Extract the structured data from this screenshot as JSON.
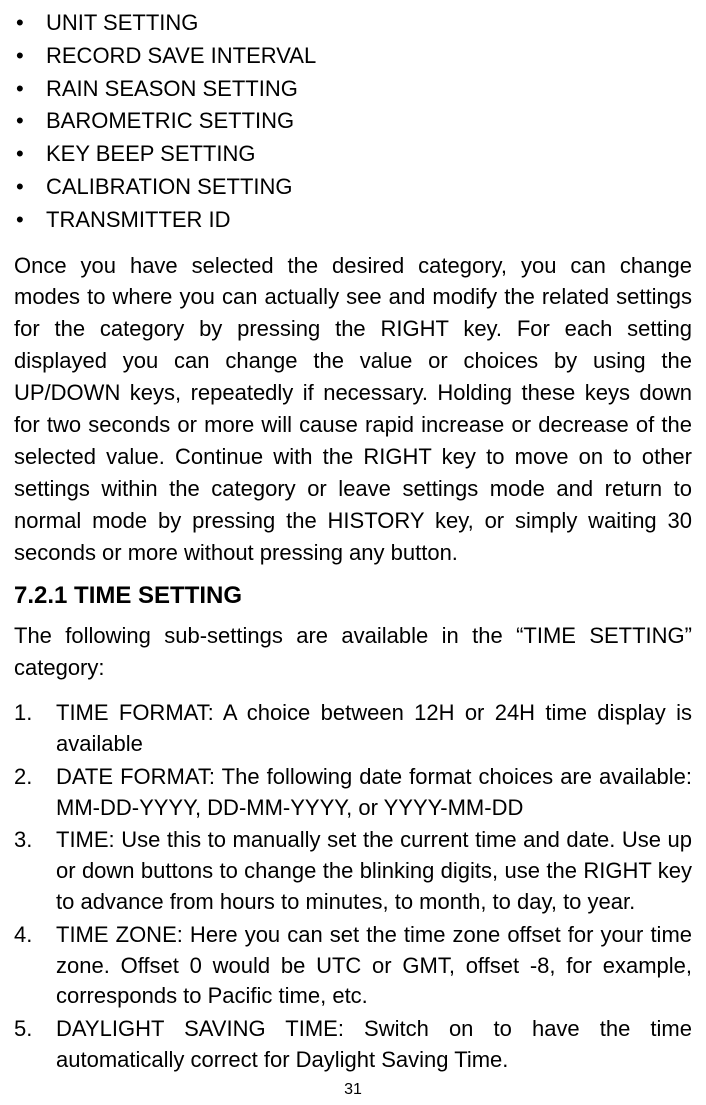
{
  "bullets": [
    "UNIT SETTING",
    "RECORD SAVE INTERVAL",
    "RAIN SEASON SETTING",
    "BAROMETRIC SETTING",
    "KEY BEEP SETTING",
    "CALIBRATION SETTING",
    "TRANSMITTER ID"
  ],
  "para1": "Once you have selected the desired category, you can change modes to where you can actually see and modify the related settings for the category by pressing the RIGHT key. For each setting displayed you can change the value or choices by using the UP/DOWN keys, repeatedly if necessary. Holding these keys down for two seconds or more will cause rapid increase or decrease of the selected value. Continue with the RIGHT key to move on to other settings within the category or leave settings mode and return to normal mode by pressing the HISTORY key, or simply waiting 30 seconds or more without pressing any button.",
  "section_heading": "7.2.1 TIME SETTING",
  "para2": "The following sub-settings are available in the “TIME SETTING” category:",
  "numbered": [
    "TIME FORMAT: A choice between 12H or 24H time display is available",
    "DATE FORMAT: The following date format choices are available: MM-DD-YYYY, DD-MM-YYYY, or YYYY-MM-DD",
    "TIME: Use this to manually set the current time and date. Use up or down buttons to change the blinking digits, use the RIGHT key to advance from hours to minutes, to month, to day, to year.",
    "TIME ZONE: Here you can set the time zone offset for your time zone. Offset 0 would be UTC or GMT, offset -8, for example, corresponds to Pacific time, etc.",
    "DAYLIGHT SAVING TIME: Switch on to have the time automatically correct for Daylight Saving Time."
  ],
  "page_number": "31"
}
